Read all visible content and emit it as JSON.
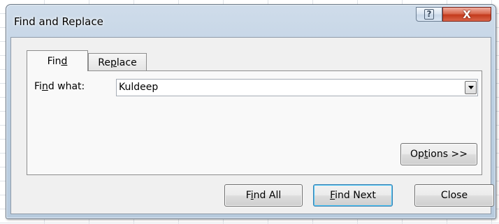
{
  "window": {
    "title": "Find and Replace",
    "help_glyph": "?",
    "close_glyph": "X"
  },
  "tabs": [
    {
      "label_pre": "Fin",
      "label_key": "d",
      "label_post": "",
      "active": true
    },
    {
      "label_pre": "Re",
      "label_key": "p",
      "label_post": "lace",
      "active": false
    }
  ],
  "find": {
    "label_pre": "Fi",
    "label_key": "n",
    "label_post": "d what:",
    "value": "Kuldeep"
  },
  "buttons": {
    "options": {
      "pre": "Op",
      "key": "t",
      "post": "ions >>"
    },
    "find_all": {
      "pre": "F",
      "key": "i",
      "post": "nd All"
    },
    "find_next": {
      "pre": "",
      "key": "F",
      "post": "ind Next"
    },
    "close": {
      "pre": "Close",
      "key": "",
      "post": ""
    }
  },
  "colors": {
    "title_bar": "#bdd0e3",
    "close_button": "#c33a1c",
    "default_button_border": "#3c7fb1"
  }
}
